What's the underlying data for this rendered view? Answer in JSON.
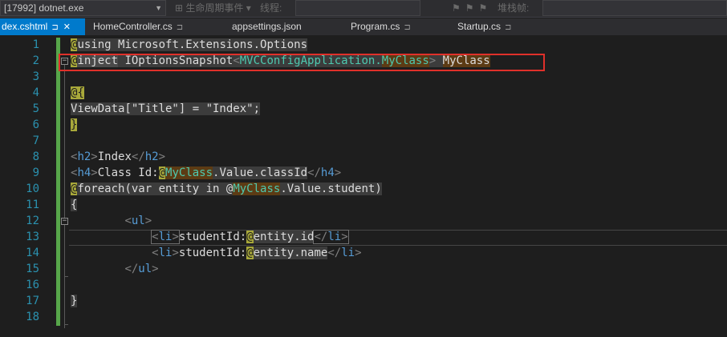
{
  "toolbar": {
    "process_label": "[17992] dotnet.exe",
    "lifecycle_label": "生命周期事件",
    "thread_label": "线程:",
    "stack_label": "堆栈帧:"
  },
  "tabs": [
    {
      "label": "Index.cshtml",
      "visible_label": "dex.cshtml",
      "active": true
    },
    {
      "label": "HomeController.cs",
      "active": false
    },
    {
      "label": "appsettings.json",
      "active": false
    },
    {
      "label": "Program.cs",
      "active": false
    },
    {
      "label": "Startup.cs",
      "active": false
    }
  ],
  "icons": {
    "pin": "pin-icon",
    "close": "close-icon",
    "dropdown": "chevron-down-icon",
    "fold": "fold-toggle-icon"
  },
  "colors": {
    "active_tab": "#007acc",
    "line_numbers": "#2b91af",
    "html_tag": "#569cd6",
    "class_type": "#4ec9b0",
    "razor_at": "#a8a83a",
    "highlight_box": "#e0302a",
    "change_bar": "#57a64a"
  },
  "line_numbers": [
    "1",
    "2",
    "3",
    "4",
    "5",
    "6",
    "7",
    "8",
    "9",
    "10",
    "11",
    "12",
    "13",
    "14",
    "15",
    "16",
    "17",
    "18"
  ],
  "code": {
    "l1": {
      "at": "@",
      "text": "using Microsoft.Extensions.Options"
    },
    "l2": {
      "at": "@",
      "kw": "inject",
      "type": " IOptionsSnapshot",
      "lt": "<",
      "ns": "MVCConfigApplication.",
      "cls": "MyClass",
      "gt": ">",
      "sp": " ",
      "var": "MyClass"
    },
    "l4": {
      "at": "@{"
    },
    "l5": {
      "text": "ViewData[\"Title\"] = \"Index\";"
    },
    "l6": {
      "brace": "}"
    },
    "l8": {
      "open": "<",
      "tag": "h2",
      "close": ">",
      "text": "Index",
      "endopen": "</",
      "endtag": "h2",
      "endclose": ">"
    },
    "l9": {
      "open": "<",
      "tag": "h4",
      "close": ">",
      "text": "Class Id:",
      "at": "@",
      "cls": "MyClass",
      "rest": ".Value.classId",
      "endopen": "</",
      "endtag": "h4",
      "endclose": ">"
    },
    "l10": {
      "at": "@",
      "text1": "foreach(var entity in @",
      "cls": "MyClass",
      "text2": ".Value.student)"
    },
    "l11": {
      "brace": "{"
    },
    "l12": {
      "indent": "        ",
      "open": "<",
      "tag": "ul",
      "close": ">"
    },
    "l13": {
      "indent": "            ",
      "open": "<",
      "tag": "li",
      "close": ">",
      "text": "studentId:",
      "at": "@",
      "rest": "entity.id",
      "endopen": "</",
      "endtag": "li",
      "endclose": ">"
    },
    "l14": {
      "indent": "            ",
      "open": "<",
      "tag": "li",
      "close": ">",
      "text": "studentId:",
      "at": "@",
      "rest": "entity.name",
      "endopen": "</",
      "endtag": "li",
      "endclose": ">"
    },
    "l15": {
      "indent": "        ",
      "endopen": "</",
      "endtag": "ul",
      "endclose": ">"
    },
    "l17": {
      "brace": "}"
    }
  }
}
